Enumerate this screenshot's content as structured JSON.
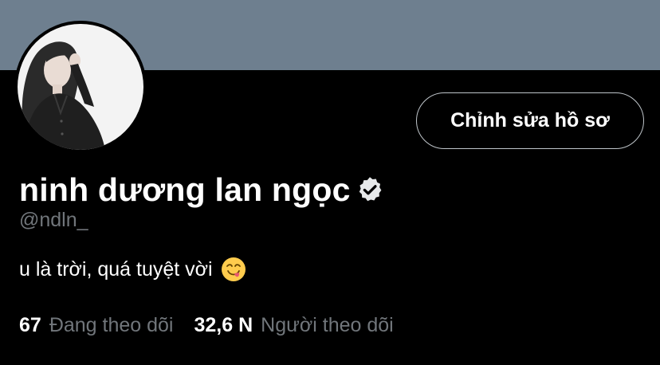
{
  "profile": {
    "name": "ninh dương lan ngọc",
    "handle": "@ndln_",
    "bio": "u là trời, quá tuyệt vời",
    "bio_emoji": "yum-emoji",
    "verified": true,
    "avatar": "profile-photo"
  },
  "actions": {
    "edit_profile_label": "Chỉnh sửa hồ sơ"
  },
  "stats": {
    "following_count": "67",
    "following_label": "Đang theo dõi",
    "followers_count": "32,6 N",
    "followers_label": "Người theo dõi"
  },
  "colors": {
    "banner": "#6e7f8f",
    "background": "#000000",
    "text_primary": "#ffffff",
    "text_secondary": "#71767b",
    "button_border": "#bfc5ca"
  }
}
